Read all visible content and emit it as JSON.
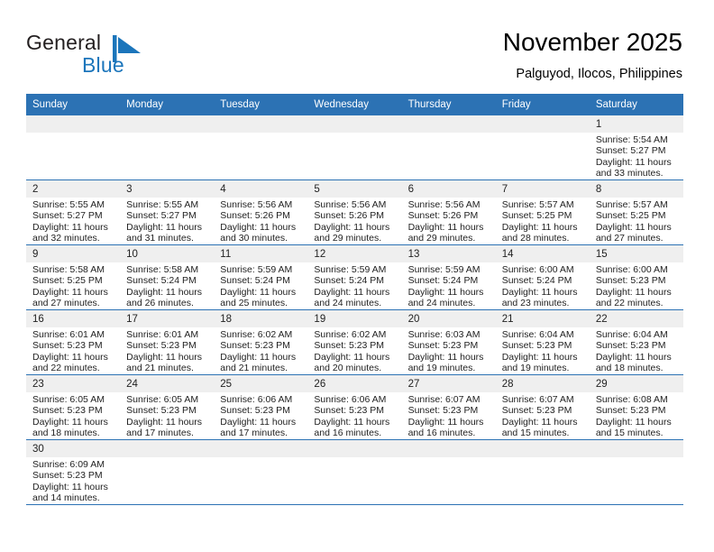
{
  "brand": {
    "name_top": "General",
    "name_bottom": "Blue",
    "mark": "blue-flag-triangle-icon",
    "color_dark": "#231f20",
    "color_blue": "#1b75bb"
  },
  "header": {
    "title": "November 2025",
    "subtitle": "Palguyod, Ilocos, Philippines"
  },
  "theme": {
    "header_blue": "#2c72b4",
    "row_divider": "#2c72b4",
    "daynum_strip": "#efefef"
  },
  "calendar": {
    "weekday_headers": [
      "Sunday",
      "Monday",
      "Tuesday",
      "Wednesday",
      "Thursday",
      "Friday",
      "Saturday"
    ],
    "weeks": [
      [
        {
          "day": "",
          "empty": true
        },
        {
          "day": "",
          "empty": true
        },
        {
          "day": "",
          "empty": true
        },
        {
          "day": "",
          "empty": true
        },
        {
          "day": "",
          "empty": true
        },
        {
          "day": "",
          "empty": true
        },
        {
          "day": "1",
          "sunrise": "Sunrise: 5:54 AM",
          "sunset": "Sunset: 5:27 PM",
          "daylight": "Daylight: 11 hours and 33 minutes."
        }
      ],
      [
        {
          "day": "2",
          "sunrise": "Sunrise: 5:55 AM",
          "sunset": "Sunset: 5:27 PM",
          "daylight": "Daylight: 11 hours and 32 minutes."
        },
        {
          "day": "3",
          "sunrise": "Sunrise: 5:55 AM",
          "sunset": "Sunset: 5:27 PM",
          "daylight": "Daylight: 11 hours and 31 minutes."
        },
        {
          "day": "4",
          "sunrise": "Sunrise: 5:56 AM",
          "sunset": "Sunset: 5:26 PM",
          "daylight": "Daylight: 11 hours and 30 minutes."
        },
        {
          "day": "5",
          "sunrise": "Sunrise: 5:56 AM",
          "sunset": "Sunset: 5:26 PM",
          "daylight": "Daylight: 11 hours and 29 minutes."
        },
        {
          "day": "6",
          "sunrise": "Sunrise: 5:56 AM",
          "sunset": "Sunset: 5:26 PM",
          "daylight": "Daylight: 11 hours and 29 minutes."
        },
        {
          "day": "7",
          "sunrise": "Sunrise: 5:57 AM",
          "sunset": "Sunset: 5:25 PM",
          "daylight": "Daylight: 11 hours and 28 minutes."
        },
        {
          "day": "8",
          "sunrise": "Sunrise: 5:57 AM",
          "sunset": "Sunset: 5:25 PM",
          "daylight": "Daylight: 11 hours and 27 minutes."
        }
      ],
      [
        {
          "day": "9",
          "sunrise": "Sunrise: 5:58 AM",
          "sunset": "Sunset: 5:25 PM",
          "daylight": "Daylight: 11 hours and 27 minutes."
        },
        {
          "day": "10",
          "sunrise": "Sunrise: 5:58 AM",
          "sunset": "Sunset: 5:24 PM",
          "daylight": "Daylight: 11 hours and 26 minutes."
        },
        {
          "day": "11",
          "sunrise": "Sunrise: 5:59 AM",
          "sunset": "Sunset: 5:24 PM",
          "daylight": "Daylight: 11 hours and 25 minutes."
        },
        {
          "day": "12",
          "sunrise": "Sunrise: 5:59 AM",
          "sunset": "Sunset: 5:24 PM",
          "daylight": "Daylight: 11 hours and 24 minutes."
        },
        {
          "day": "13",
          "sunrise": "Sunrise: 5:59 AM",
          "sunset": "Sunset: 5:24 PM",
          "daylight": "Daylight: 11 hours and 24 minutes."
        },
        {
          "day": "14",
          "sunrise": "Sunrise: 6:00 AM",
          "sunset": "Sunset: 5:24 PM",
          "daylight": "Daylight: 11 hours and 23 minutes."
        },
        {
          "day": "15",
          "sunrise": "Sunrise: 6:00 AM",
          "sunset": "Sunset: 5:23 PM",
          "daylight": "Daylight: 11 hours and 22 minutes."
        }
      ],
      [
        {
          "day": "16",
          "sunrise": "Sunrise: 6:01 AM",
          "sunset": "Sunset: 5:23 PM",
          "daylight": "Daylight: 11 hours and 22 minutes."
        },
        {
          "day": "17",
          "sunrise": "Sunrise: 6:01 AM",
          "sunset": "Sunset: 5:23 PM",
          "daylight": "Daylight: 11 hours and 21 minutes."
        },
        {
          "day": "18",
          "sunrise": "Sunrise: 6:02 AM",
          "sunset": "Sunset: 5:23 PM",
          "daylight": "Daylight: 11 hours and 21 minutes."
        },
        {
          "day": "19",
          "sunrise": "Sunrise: 6:02 AM",
          "sunset": "Sunset: 5:23 PM",
          "daylight": "Daylight: 11 hours and 20 minutes."
        },
        {
          "day": "20",
          "sunrise": "Sunrise: 6:03 AM",
          "sunset": "Sunset: 5:23 PM",
          "daylight": "Daylight: 11 hours and 19 minutes."
        },
        {
          "day": "21",
          "sunrise": "Sunrise: 6:04 AM",
          "sunset": "Sunset: 5:23 PM",
          "daylight": "Daylight: 11 hours and 19 minutes."
        },
        {
          "day": "22",
          "sunrise": "Sunrise: 6:04 AM",
          "sunset": "Sunset: 5:23 PM",
          "daylight": "Daylight: 11 hours and 18 minutes."
        }
      ],
      [
        {
          "day": "23",
          "sunrise": "Sunrise: 6:05 AM",
          "sunset": "Sunset: 5:23 PM",
          "daylight": "Daylight: 11 hours and 18 minutes."
        },
        {
          "day": "24",
          "sunrise": "Sunrise: 6:05 AM",
          "sunset": "Sunset: 5:23 PM",
          "daylight": "Daylight: 11 hours and 17 minutes."
        },
        {
          "day": "25",
          "sunrise": "Sunrise: 6:06 AM",
          "sunset": "Sunset: 5:23 PM",
          "daylight": "Daylight: 11 hours and 17 minutes."
        },
        {
          "day": "26",
          "sunrise": "Sunrise: 6:06 AM",
          "sunset": "Sunset: 5:23 PM",
          "daylight": "Daylight: 11 hours and 16 minutes."
        },
        {
          "day": "27",
          "sunrise": "Sunrise: 6:07 AM",
          "sunset": "Sunset: 5:23 PM",
          "daylight": "Daylight: 11 hours and 16 minutes."
        },
        {
          "day": "28",
          "sunrise": "Sunrise: 6:07 AM",
          "sunset": "Sunset: 5:23 PM",
          "daylight": "Daylight: 11 hours and 15 minutes."
        },
        {
          "day": "29",
          "sunrise": "Sunrise: 6:08 AM",
          "sunset": "Sunset: 5:23 PM",
          "daylight": "Daylight: 11 hours and 15 minutes."
        }
      ],
      [
        {
          "day": "30",
          "sunrise": "Sunrise: 6:09 AM",
          "sunset": "Sunset: 5:23 PM",
          "daylight": "Daylight: 11 hours and 14 minutes."
        },
        {
          "day": "",
          "empty": true
        },
        {
          "day": "",
          "empty": true
        },
        {
          "day": "",
          "empty": true
        },
        {
          "day": "",
          "empty": true
        },
        {
          "day": "",
          "empty": true
        },
        {
          "day": "",
          "empty": true
        }
      ]
    ]
  }
}
